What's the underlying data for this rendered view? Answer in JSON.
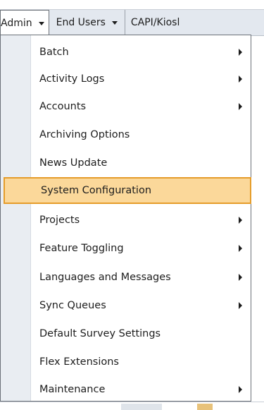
{
  "menubar": {
    "items": [
      {
        "label": "Admin"
      },
      {
        "label": "End Users"
      },
      {
        "label": "CAPI/Kiosl"
      }
    ]
  },
  "dropdown": {
    "items": [
      {
        "label": "Batch",
        "submenu": true
      },
      {
        "label": "Activity Logs",
        "submenu": true
      },
      {
        "label": "Accounts",
        "submenu": true
      },
      {
        "label": "Archiving Options",
        "submenu": false
      },
      {
        "label": "News Update",
        "submenu": false
      },
      {
        "label": "System Configuration",
        "submenu": false,
        "highlighted": true
      },
      {
        "label": "Projects",
        "submenu": true
      },
      {
        "label": "Feature Toggling",
        "submenu": true
      },
      {
        "label": "Languages and Messages",
        "submenu": true
      },
      {
        "label": "Sync Queues",
        "submenu": true
      },
      {
        "label": "Default Survey Settings",
        "submenu": false
      },
      {
        "label": "Flex Extensions",
        "submenu": false
      },
      {
        "label": "Maintenance",
        "submenu": true
      }
    ]
  },
  "colors": {
    "highlight_bg": "#fbd89a",
    "highlight_border": "#e59c2a",
    "menubar_bg": "#e3e8ef",
    "gutter_bg": "#e9edf2"
  }
}
